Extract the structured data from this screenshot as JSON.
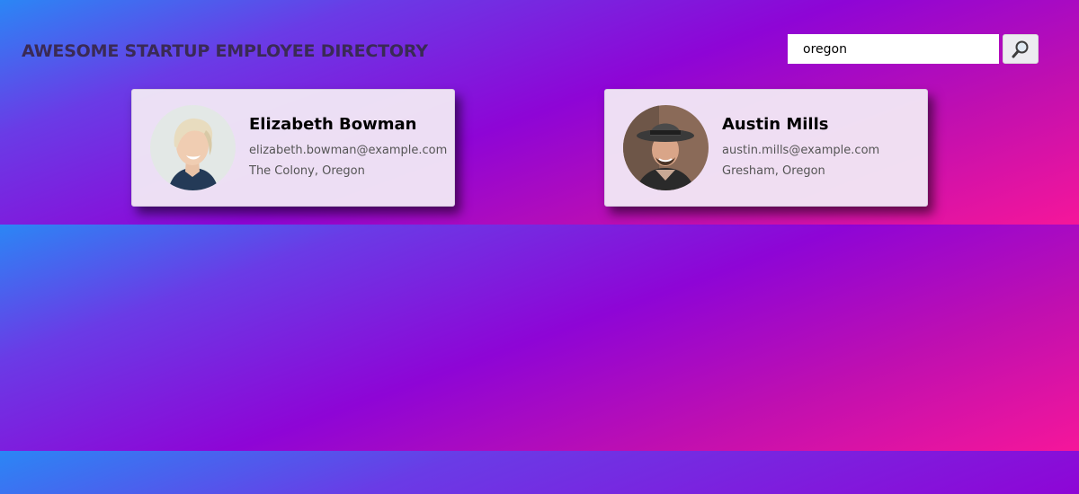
{
  "header": {
    "title": "AWESOME STARTUP EMPLOYEE DIRECTORY"
  },
  "search": {
    "value": "oregon",
    "icon": "magnifying-glass-icon"
  },
  "employees": [
    {
      "name": "Elizabeth Bowman",
      "email": "elizabeth.bowman@example.com",
      "location": "The Colony, Oregon"
    },
    {
      "name": "Austin Mills",
      "email": "austin.mills@example.com",
      "location": "Gresham, Oregon"
    }
  ],
  "colors": {
    "gradient_start": "#2b86f5",
    "gradient_mid": "#8e05d6",
    "gradient_end": "#f5169a",
    "title": "#3a2a55",
    "card_bg": "#f2eaf6"
  }
}
